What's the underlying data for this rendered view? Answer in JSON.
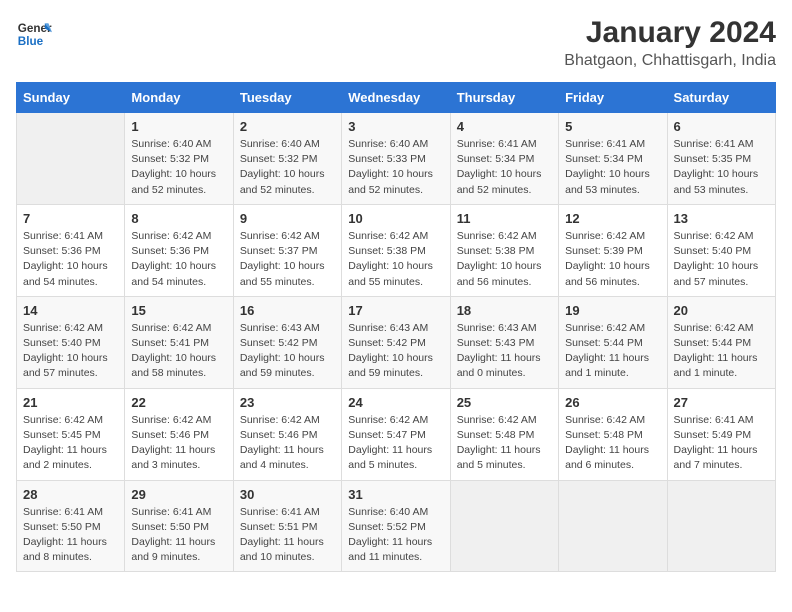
{
  "logo": {
    "line1": "General",
    "line2": "Blue"
  },
  "title": "January 2024",
  "subtitle": "Bhatgaon, Chhattisgarh, India",
  "days_of_week": [
    "Sunday",
    "Monday",
    "Tuesday",
    "Wednesday",
    "Thursday",
    "Friday",
    "Saturday"
  ],
  "weeks": [
    [
      {
        "day": "",
        "info": ""
      },
      {
        "day": "1",
        "info": "Sunrise: 6:40 AM\nSunset: 5:32 PM\nDaylight: 10 hours\nand 52 minutes."
      },
      {
        "day": "2",
        "info": "Sunrise: 6:40 AM\nSunset: 5:32 PM\nDaylight: 10 hours\nand 52 minutes."
      },
      {
        "day": "3",
        "info": "Sunrise: 6:40 AM\nSunset: 5:33 PM\nDaylight: 10 hours\nand 52 minutes."
      },
      {
        "day": "4",
        "info": "Sunrise: 6:41 AM\nSunset: 5:34 PM\nDaylight: 10 hours\nand 52 minutes."
      },
      {
        "day": "5",
        "info": "Sunrise: 6:41 AM\nSunset: 5:34 PM\nDaylight: 10 hours\nand 53 minutes."
      },
      {
        "day": "6",
        "info": "Sunrise: 6:41 AM\nSunset: 5:35 PM\nDaylight: 10 hours\nand 53 minutes."
      }
    ],
    [
      {
        "day": "7",
        "info": "Sunrise: 6:41 AM\nSunset: 5:36 PM\nDaylight: 10 hours\nand 54 minutes."
      },
      {
        "day": "8",
        "info": "Sunrise: 6:42 AM\nSunset: 5:36 PM\nDaylight: 10 hours\nand 54 minutes."
      },
      {
        "day": "9",
        "info": "Sunrise: 6:42 AM\nSunset: 5:37 PM\nDaylight: 10 hours\nand 55 minutes."
      },
      {
        "day": "10",
        "info": "Sunrise: 6:42 AM\nSunset: 5:38 PM\nDaylight: 10 hours\nand 55 minutes."
      },
      {
        "day": "11",
        "info": "Sunrise: 6:42 AM\nSunset: 5:38 PM\nDaylight: 10 hours\nand 56 minutes."
      },
      {
        "day": "12",
        "info": "Sunrise: 6:42 AM\nSunset: 5:39 PM\nDaylight: 10 hours\nand 56 minutes."
      },
      {
        "day": "13",
        "info": "Sunrise: 6:42 AM\nSunset: 5:40 PM\nDaylight: 10 hours\nand 57 minutes."
      }
    ],
    [
      {
        "day": "14",
        "info": "Sunrise: 6:42 AM\nSunset: 5:40 PM\nDaylight: 10 hours\nand 57 minutes."
      },
      {
        "day": "15",
        "info": "Sunrise: 6:42 AM\nSunset: 5:41 PM\nDaylight: 10 hours\nand 58 minutes."
      },
      {
        "day": "16",
        "info": "Sunrise: 6:43 AM\nSunset: 5:42 PM\nDaylight: 10 hours\nand 59 minutes."
      },
      {
        "day": "17",
        "info": "Sunrise: 6:43 AM\nSunset: 5:42 PM\nDaylight: 10 hours\nand 59 minutes."
      },
      {
        "day": "18",
        "info": "Sunrise: 6:43 AM\nSunset: 5:43 PM\nDaylight: 11 hours\nand 0 minutes."
      },
      {
        "day": "19",
        "info": "Sunrise: 6:42 AM\nSunset: 5:44 PM\nDaylight: 11 hours\nand 1 minute."
      },
      {
        "day": "20",
        "info": "Sunrise: 6:42 AM\nSunset: 5:44 PM\nDaylight: 11 hours\nand 1 minute."
      }
    ],
    [
      {
        "day": "21",
        "info": "Sunrise: 6:42 AM\nSunset: 5:45 PM\nDaylight: 11 hours\nand 2 minutes."
      },
      {
        "day": "22",
        "info": "Sunrise: 6:42 AM\nSunset: 5:46 PM\nDaylight: 11 hours\nand 3 minutes."
      },
      {
        "day": "23",
        "info": "Sunrise: 6:42 AM\nSunset: 5:46 PM\nDaylight: 11 hours\nand 4 minutes."
      },
      {
        "day": "24",
        "info": "Sunrise: 6:42 AM\nSunset: 5:47 PM\nDaylight: 11 hours\nand 5 minutes."
      },
      {
        "day": "25",
        "info": "Sunrise: 6:42 AM\nSunset: 5:48 PM\nDaylight: 11 hours\nand 5 minutes."
      },
      {
        "day": "26",
        "info": "Sunrise: 6:42 AM\nSunset: 5:48 PM\nDaylight: 11 hours\nand 6 minutes."
      },
      {
        "day": "27",
        "info": "Sunrise: 6:41 AM\nSunset: 5:49 PM\nDaylight: 11 hours\nand 7 minutes."
      }
    ],
    [
      {
        "day": "28",
        "info": "Sunrise: 6:41 AM\nSunset: 5:50 PM\nDaylight: 11 hours\nand 8 minutes."
      },
      {
        "day": "29",
        "info": "Sunrise: 6:41 AM\nSunset: 5:50 PM\nDaylight: 11 hours\nand 9 minutes."
      },
      {
        "day": "30",
        "info": "Sunrise: 6:41 AM\nSunset: 5:51 PM\nDaylight: 11 hours\nand 10 minutes."
      },
      {
        "day": "31",
        "info": "Sunrise: 6:40 AM\nSunset: 5:52 PM\nDaylight: 11 hours\nand 11 minutes."
      },
      {
        "day": "",
        "info": ""
      },
      {
        "day": "",
        "info": ""
      },
      {
        "day": "",
        "info": ""
      }
    ]
  ]
}
